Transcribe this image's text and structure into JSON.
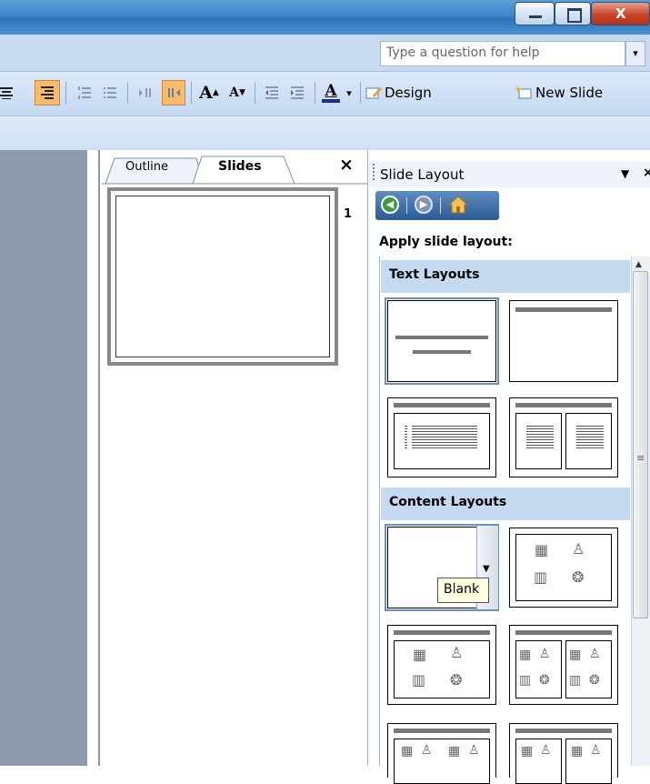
{
  "help": {
    "placeholder": "Type a question for help",
    "dropdown": "▾"
  },
  "toolbar": {
    "design_label": "Design",
    "new_slide_label": "New Slide",
    "font_color_letter": "A",
    "grow_font": "A",
    "shrink_font": "A"
  },
  "tabs": [
    {
      "label": "Outline"
    },
    {
      "label": "Slides"
    }
  ],
  "pane_close": "×",
  "slide_number": "1",
  "task_pane": {
    "title": "Slide Layout",
    "title_arrow": "▼",
    "apply_label": "Apply slide layout:",
    "sections": [
      {
        "label": "Text Layouts"
      },
      {
        "label": "Content Layouts"
      }
    ],
    "tooltip": "Blank",
    "scroll_up": "▲",
    "scroll_grip": "≡"
  },
  "window": {
    "close": "X",
    "minimize": "—",
    "maximize": "❐"
  },
  "icons": {
    "back": "back-arrow-icon",
    "forward": "forward-arrow-icon",
    "home": "home-icon"
  },
  "colors": {
    "titlebar": "#3f85c8",
    "section_header": "#c5daf0",
    "active_button": "#f7bb6e"
  }
}
